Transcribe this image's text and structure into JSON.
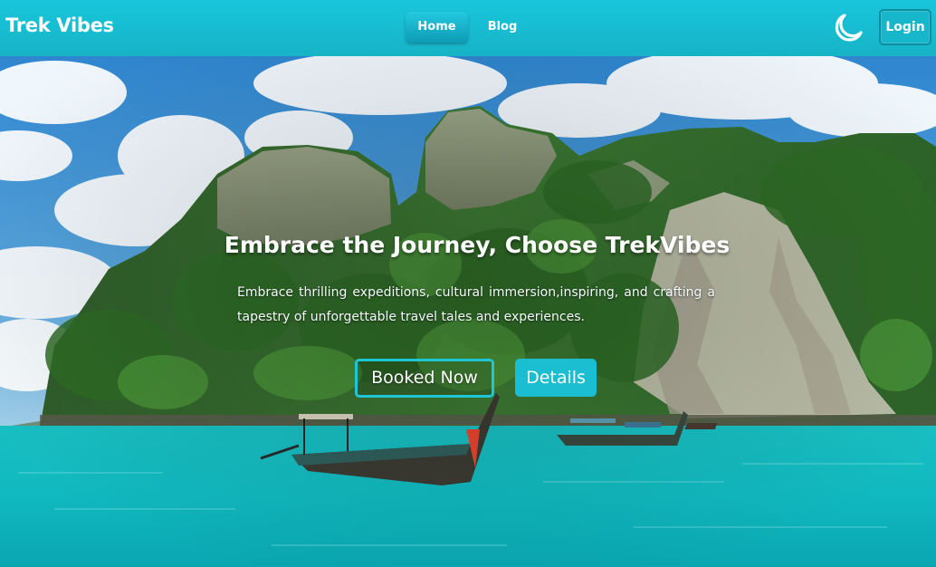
{
  "navbar": {
    "brand": "Trek Vibes",
    "links": [
      {
        "label": "Home",
        "active": true
      },
      {
        "label": "Blog",
        "active": false
      }
    ],
    "theme_toggle_icon": "moon-icon",
    "login_label": "Login"
  },
  "hero": {
    "background": "tropical-island-bay-with-longtail-boats",
    "headline": "Embrace the Journey, Choose TrekVibes",
    "subtext": "Embrace thrilling expeditions, cultural immersion,inspiring, and crafting a tapestry of unforgettable travel tales and experiences.",
    "primary_button": "Booked Now",
    "secondary_button": "Details"
  },
  "colors": {
    "nav_bg": "#18c6dc",
    "accent": "#1bbdd0",
    "text": "#ffffff"
  }
}
